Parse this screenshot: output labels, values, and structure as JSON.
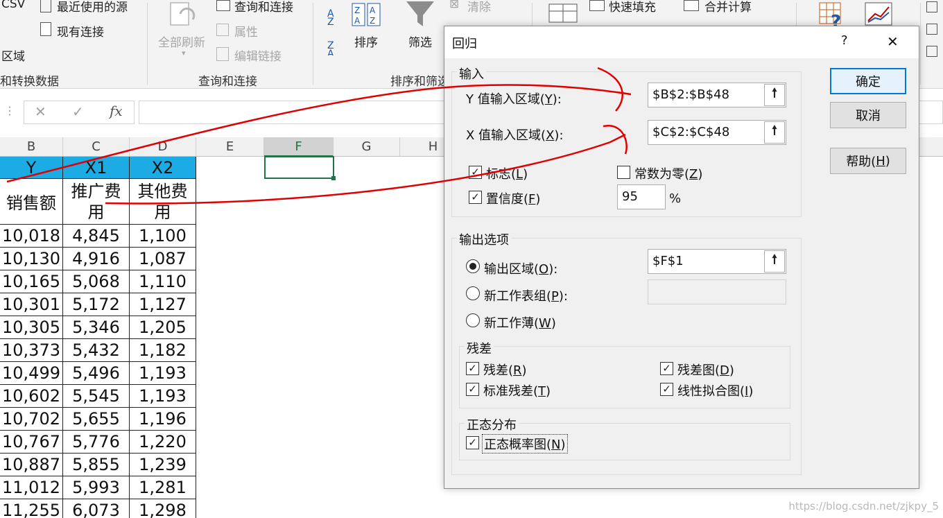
{
  "ribbon": {
    "csv_label": "CSV",
    "recent_sources": "最近使用的源",
    "existing_connections": "现有连接",
    "from_range": "区域",
    "group_get_transform": "和转换数据",
    "refresh_all": "全部刷新",
    "queries_connections": "查询和连接",
    "properties": "属性",
    "edit_links": "编辑链接",
    "group_queries": "查询和连接",
    "sort": "排序",
    "filter": "筛选",
    "clear": "清除",
    "group_sort_filter": "排序和筛选",
    "flash_fill": "快速填充",
    "consolidate": "合并计算"
  },
  "formula_bar": {
    "cancel": "✕",
    "enter": "✓",
    "fx": "fx",
    "value": ""
  },
  "sheet": {
    "columns": [
      "B",
      "C",
      "D",
      "E",
      "F",
      "G",
      "H"
    ],
    "selected_column": "F",
    "header_row": [
      "Y",
      "X1",
      "X2"
    ],
    "label_row": [
      [
        "销售额"
      ],
      [
        "推广费",
        "用"
      ],
      [
        "其他费",
        "用"
      ]
    ],
    "rows": [
      [
        "10,018",
        "4,845",
        "1,100"
      ],
      [
        "10,130",
        "4,916",
        "1,087"
      ],
      [
        "10,165",
        "5,068",
        "1,110"
      ],
      [
        "10,301",
        "5,172",
        "1,127"
      ],
      [
        "10,305",
        "5,346",
        "1,205"
      ],
      [
        "10,373",
        "5,432",
        "1,182"
      ],
      [
        "10,499",
        "5,496",
        "1,193"
      ],
      [
        "10,602",
        "5,545",
        "1,193"
      ],
      [
        "10,702",
        "5,655",
        "1,196"
      ],
      [
        "10,767",
        "5,776",
        "1,220"
      ],
      [
        "10,887",
        "5,855",
        "1,239"
      ],
      [
        "11,012",
        "5,993",
        "1,281"
      ],
      [
        "11,255",
        "6,073",
        "1,298"
      ]
    ]
  },
  "dialog": {
    "title": "回归",
    "help_glyph": "?",
    "close_glyph": "✕",
    "input_legend": "输入",
    "y_range_label": "Y 值输入区域(",
    "y_range_key": "Y",
    "y_range_tail": "):",
    "y_range_value": "$B$2:$B$48",
    "x_range_label": "X 值输入区域(",
    "x_range_key": "X",
    "x_range_tail": "):",
    "x_range_value": "$C$2:$C$48",
    "labels_text": "标志(",
    "labels_key": "L",
    "labels_tail": ")",
    "labels_checked": true,
    "const_zero_text": "常数为零(",
    "const_zero_key": "Z",
    "const_zero_tail": ")",
    "const_zero_checked": false,
    "confidence_text": "置信度(",
    "confidence_key": "F",
    "confidence_tail": ")",
    "confidence_checked": true,
    "confidence_value": "95",
    "percent": "%",
    "output_legend": "输出选项",
    "output_range_text": "输出区域(",
    "output_range_key": "O",
    "output_range_tail": "):",
    "output_range_value": "$F$1",
    "new_sheet_text": "新工作表组(",
    "new_sheet_key": "P",
    "new_sheet_tail": "):",
    "new_sheet_value": "",
    "new_book_text": "新工作薄(",
    "new_book_key": "W",
    "new_book_tail": ")",
    "residuals_legend": "残差",
    "residuals_text": "残差(",
    "residuals_key": "R",
    "residuals_tail": ")",
    "std_residuals_text": "标准残差(",
    "std_residuals_key": "T",
    "std_residuals_tail": ")",
    "residual_plots_text": "残差图(",
    "residual_plots_key": "D",
    "residual_plots_tail": ")",
    "line_fit_text": "线性拟合图(",
    "line_fit_key": "I",
    "line_fit_tail": ")",
    "normal_legend": "正态分布",
    "normal_plot_text": "正态概率图(",
    "normal_plot_key": "N",
    "normal_plot_tail": ")",
    "ok": "确定",
    "cancel": "取消",
    "help_text": "帮助(",
    "help_key": "H",
    "help_tail": ")"
  },
  "watermark": "https://blog.csdn.net/zjkpy_5",
  "colors": {
    "accent": "#0078d7",
    "header_fill": "#1cabe2",
    "annotation": "#e00000",
    "selection": "#217346"
  }
}
